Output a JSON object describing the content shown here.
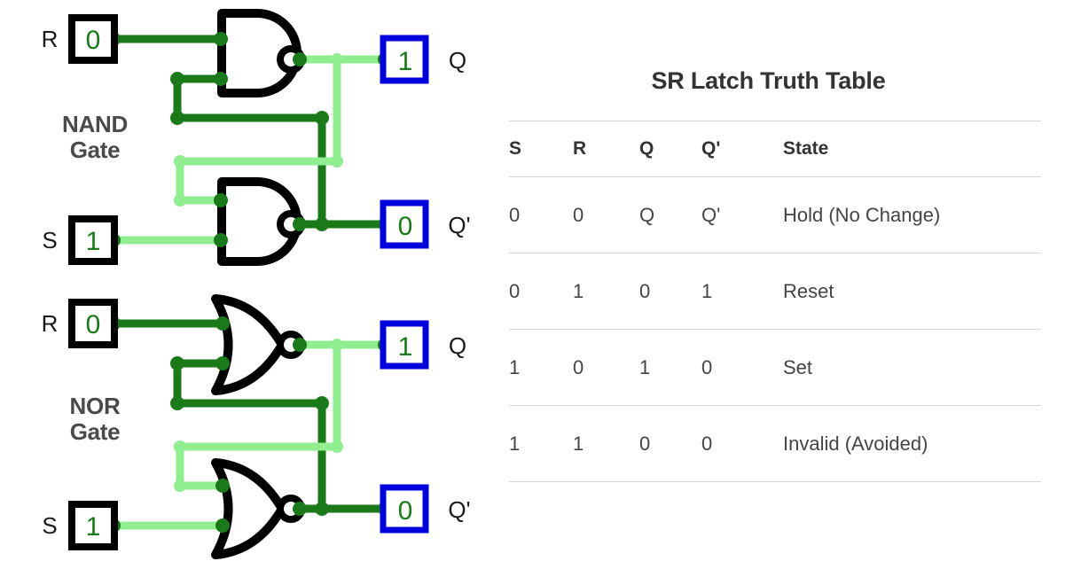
{
  "circuit": {
    "sections": [
      {
        "id": "nand",
        "label": "NAND\nGate",
        "gate_type": "nand",
        "inputs": [
          {
            "name": "R",
            "label": "R",
            "value": "0",
            "level": "low"
          },
          {
            "name": "S",
            "label": "S",
            "value": "1",
            "level": "high"
          }
        ],
        "outputs": [
          {
            "name": "Q",
            "label": "Q",
            "value": "1",
            "level": "high"
          },
          {
            "name": "Qprime",
            "label": "Q'",
            "value": "0",
            "level": "low"
          }
        ]
      },
      {
        "id": "nor",
        "label": "NOR\nGate",
        "gate_type": "nor",
        "inputs": [
          {
            "name": "R",
            "label": "R",
            "value": "0",
            "level": "low"
          },
          {
            "name": "S",
            "label": "S",
            "value": "1",
            "level": "high"
          }
        ],
        "outputs": [
          {
            "name": "Q",
            "label": "Q",
            "value": "1",
            "level": "high"
          },
          {
            "name": "Qprime",
            "label": "Q'",
            "value": "0",
            "level": "low"
          }
        ]
      }
    ],
    "colors": {
      "wire_low": "#90ee90",
      "wire_high": "#1a7a1a",
      "gate_outline": "#000000",
      "input_box_border": "#000000",
      "output_box_border": "#0000dd",
      "digit": "#1a7a1a",
      "terminal_label": "#1a1a1a",
      "section_label": "#4a4a4a"
    }
  },
  "table": {
    "title": "SR Latch Truth Table",
    "headers": [
      "S",
      "R",
      "Q",
      "Q'",
      "State"
    ],
    "rows": [
      {
        "S": "0",
        "R": "0",
        "Q": "Q",
        "Qp": "Q'",
        "state": "Hold (No Change)"
      },
      {
        "S": "0",
        "R": "1",
        "Q": "0",
        "Qp": "1",
        "state": "Reset"
      },
      {
        "S": "1",
        "R": "0",
        "Q": "1",
        "Qp": "0",
        "state": "Set"
      },
      {
        "S": "1",
        "R": "1",
        "Q": "0",
        "Qp": "0",
        "state": "Invalid (Avoided)"
      }
    ]
  }
}
